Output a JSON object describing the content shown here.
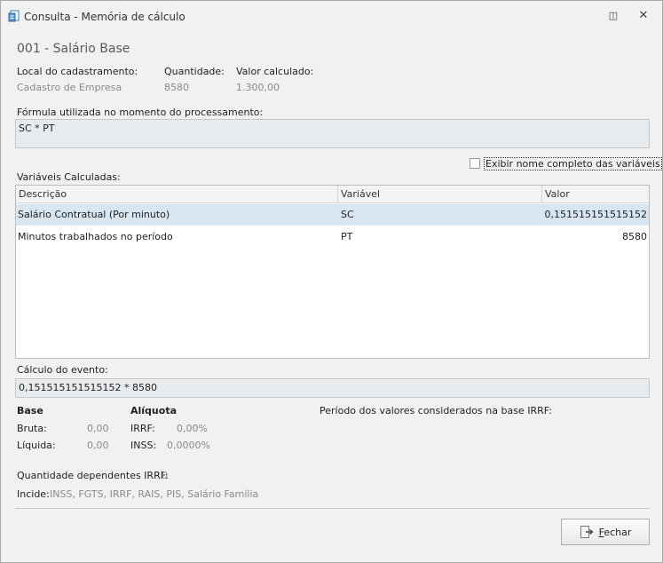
{
  "window": {
    "title": "Consulta - Memória de cálculo",
    "restore_glyph": "◫",
    "close_glyph": "✕",
    "icon": "document-calc-icon"
  },
  "header": {
    "section_title": "001 - Salário Base"
  },
  "info": {
    "local_label": "Local do cadastramento:",
    "local_value": "Cadastro de Empresa",
    "quantidade_label": "Quantidade:",
    "quantidade_value": "8580",
    "valor_label": "Valor calculado:",
    "valor_value": "1.300,00"
  },
  "formula": {
    "label": "Fórmula utilizada no momento do processamento:",
    "value": "SC * PT"
  },
  "options": {
    "show_full_names_label": "Exibir nome completo das variáveis",
    "show_full_names_checked": false
  },
  "variables": {
    "label": "Variáveis Calculadas:",
    "columns": [
      "Descrição",
      "Variável",
      "Valor"
    ],
    "rows": [
      {
        "descricao": "Salário Contratual (Por minuto)",
        "variavel": "SC",
        "valor": "0,151515151515152"
      },
      {
        "descricao": "Minutos trabalhados no período",
        "variavel": "PT",
        "valor": "8580"
      }
    ],
    "selected_row": 0,
    "selected_color": "#d8e6f2"
  },
  "evento": {
    "label": "Cálculo do evento:",
    "value": "0,151515151515152 * 8580"
  },
  "base": {
    "title": "Base",
    "bruta_label": "Bruta:",
    "bruta_value": "0,00",
    "liquida_label": "Líquida:",
    "liquida_value": "0,00"
  },
  "aliquota": {
    "title": "Alíquota",
    "irrf_label": "IRRF:",
    "irrf_value": "0,00%",
    "inss_label": "INSS:",
    "inss_value": "0,0000%"
  },
  "periodo": {
    "label": "Período dos valores considerados na base IRRF:"
  },
  "dependentes": {
    "label": "Quantidade dependentes IRRF:",
    "value": "0"
  },
  "incide": {
    "label": "Incide:",
    "value": "INSS, FGTS, IRRF, RAIS, PIS, Salário Família"
  },
  "footer": {
    "close_label": "Fechar",
    "close_icon": "exit-icon"
  }
}
